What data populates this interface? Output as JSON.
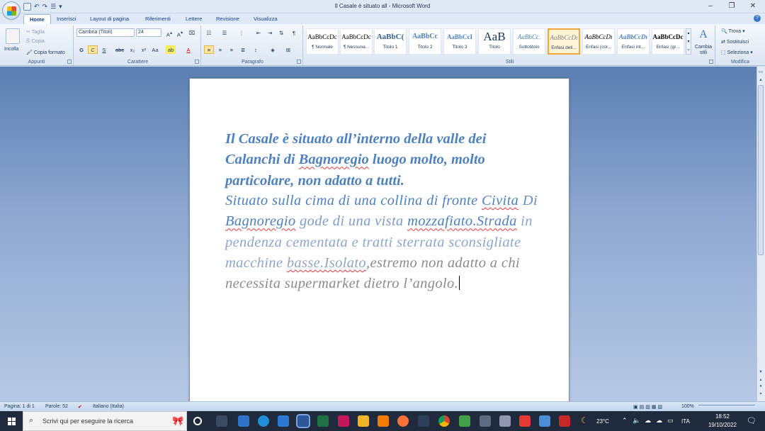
{
  "window": {
    "title": "Il Casale è situato all - Microsoft Word",
    "minimize": "–",
    "restore": "❐",
    "close": "✕"
  },
  "qat": {
    "save": "💾",
    "undo": "↶",
    "redo": "↷",
    "more": "▾"
  },
  "tabs": [
    "Home",
    "Inserisci",
    "Layout di pagina",
    "Riferimenti",
    "Lettere",
    "Revisione",
    "Visualizza"
  ],
  "ribbon": {
    "clipboard": {
      "label": "Appunti",
      "paste": "Incolla",
      "cut": "Taglia",
      "copy": "Copia",
      "format_painter": "Copia formato"
    },
    "font": {
      "label": "Carattere",
      "font_name": "Cambria (Titoli)",
      "font_size": "24"
    },
    "paragraph": {
      "label": "Paragrafo"
    },
    "styles": {
      "label": "Stili",
      "items": [
        {
          "preview": "AaBbCcDc",
          "name": "¶ Normale"
        },
        {
          "preview": "AaBbCcDc",
          "name": "¶ Nessuna..."
        },
        {
          "preview": "AaBbC(",
          "name": "Titolo 1"
        },
        {
          "preview": "AaBbCc",
          "name": "Titolo 2"
        },
        {
          "preview": "AaBbCcI",
          "name": "Titolo 3"
        },
        {
          "preview": "AaB",
          "name": "Titolo"
        },
        {
          "preview": "AaBbCc.",
          "name": "Sottotitolo"
        },
        {
          "preview": "AaBbCcDı",
          "name": "Enfasi deli..."
        },
        {
          "preview": "AaBbCcDı",
          "name": "Enfasi (cor..."
        },
        {
          "preview": "AaBbCcDı",
          "name": "Enfasi int..."
        },
        {
          "preview": "AaBbCcDc",
          "name": "Enfasi (gr..."
        }
      ],
      "change_styles": "Cambia stili"
    },
    "editing": {
      "label": "Modifica",
      "find": "Trova",
      "replace": "Sostituisci",
      "select": "Seleziona"
    }
  },
  "document": {
    "heading": {
      "p1": "Il Casale è situato all’interno della valle dei Calanchi di ",
      "w1": "Bagnoregio",
      "p2": " luogo molto, molto particolare, non adatto a tutti."
    },
    "body": {
      "p1": "Situato sulla cima di una collina di fronte ",
      "w1": "Civita",
      "p2": " Di ",
      "w2": "Bagnoregio",
      "p3": " gode di una vista ",
      "w3": "mozzafiato.Strada",
      "p4": " in pendenza cementata e tratti sterrata sconsigliate macchine ",
      "w4": "basse.Isolato",
      "p5": ",estremo non adatto a chi necessita supermarket dietro l’angolo."
    }
  },
  "status": {
    "page": "Pagina: 1 di 1",
    "words": "Parole: 52",
    "language": "Italiano (Italia)",
    "zoom": "100%"
  },
  "taskbar": {
    "search_placeholder": "Scrivi qui per eseguire la ricerca",
    "weather": "23°C",
    "language": "ITA",
    "time": "18:52",
    "date": "19/10/2022"
  }
}
